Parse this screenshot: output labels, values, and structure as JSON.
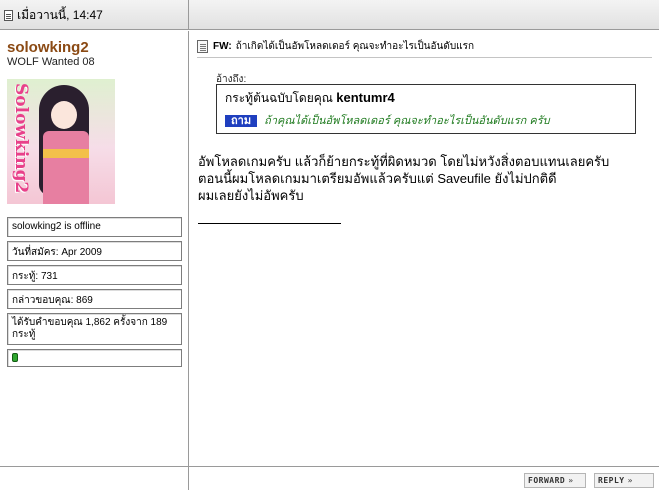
{
  "header": {
    "date": "เมื่อวานนี้, 14:47"
  },
  "user": {
    "name": "solowking2",
    "title": "WOLF Wanted 08",
    "avatar_signature": "Solowking2",
    "status": "solowking2 is offline",
    "join_date": "วันที่สมัคร: Apr 2009",
    "posts": "กระทู้: 731",
    "thanks_given": "กล่าวขอบคุณ: 869",
    "thanks_received": "ได้รับคำขอบคุณ 1,862 ครั้งจาก 189 กระทู้"
  },
  "post": {
    "title_prefix": "FW:",
    "title": "ถ้าเกิดได้เป็นอัพโหลดเดอร์ คุณจะทำอะไรเป็นอันดับแรก",
    "quote_label": "อ้างถึง:",
    "quote_by_prefix": "กระทู้ต้นฉบับโดยคุณ",
    "quote_by_user": "kentumr4",
    "quote_tag": "ถาม",
    "quote_text": "ถ้าคุณได้เป็นอัพโหลดเดอร์ คุณจะทำอะไรเป็นอันดับแรก ครับ",
    "message_lines": [
      "อัพโหลดเกมครับ แล้วก็ย้ายกระทู้ที่ผิดหมวด โดยไม่หวังสิ่งตอบแทนเลยครับ",
      "ตอนนี้ผมโหลดเกมมาเตรียมอัพแล้วครับแต่ Saveufile ยังไม่ปกติดี",
      "ผมเลยยังไม่อัพครับ"
    ]
  },
  "footer": {
    "forward_label": "FORWARD",
    "reply_label": "REPLY"
  },
  "colors": {
    "username": "#8b4a14",
    "quote_tag_bg": "#1f3fbf",
    "quote_text": "#1e7a1e",
    "online_dot": "#2fa62f"
  }
}
